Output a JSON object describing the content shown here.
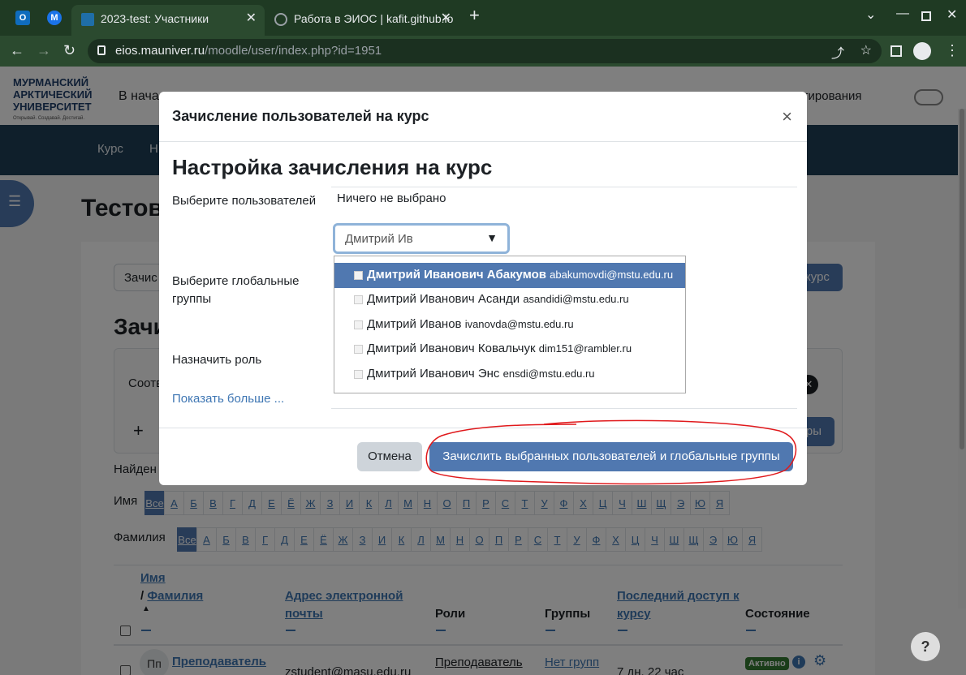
{
  "browser": {
    "tabs": [
      {
        "title": "2023-test: Участники"
      },
      {
        "title": "Работа в ЭИОС | kafit.github.io"
      }
    ],
    "new_tab": "+",
    "url_host": "eios.mauniver.ru",
    "url_path": "/moodle/user/index.php?id=1951"
  },
  "header": {
    "logo_line1": "МУРМАНСКИЙ",
    "logo_line2": "АРКТИЧЕСКИЙ",
    "logo_line3": "УНИВЕРСИТЕТ",
    "logo_tag": "Открывай. Создавай. Достигай.",
    "home_partial": "В начал",
    "edit_mode": "м редактирования"
  },
  "nav": {
    "course": "Курс",
    "second": "Н"
  },
  "background": {
    "page_title_partial": "Тестов",
    "enrol_input_partial": "Зачис",
    "enrol_btn_partial": "курс",
    "section_partial": "Зачи",
    "match_partial": "Соотв",
    "plus": "+",
    "filters_partial": "тры",
    "found_partial": "Найден",
    "name_label": "Имя",
    "surname_label": "Фамилия",
    "all": "Все",
    "letters": [
      "А",
      "Б",
      "В",
      "Г",
      "Д",
      "Е",
      "Ё",
      "Ж",
      "З",
      "И",
      "К",
      "Л",
      "М",
      "Н",
      "О",
      "П",
      "Р",
      "С",
      "Т",
      "У",
      "Ф",
      "Х",
      "Ц",
      "Ч",
      "Ш",
      "Щ",
      "Э",
      "Ю",
      "Я"
    ],
    "table": {
      "col_name_first": "Имя",
      "col_name_sep": "/",
      "col_name_last": "Фамилия",
      "col_email_1": "Адрес электронной",
      "col_email_2": "почты",
      "col_roles": "Роли",
      "col_groups": "Группы",
      "col_access_1": "Последний доступ к",
      "col_access_2": "курсу",
      "col_status": "Состояние",
      "row_initials": "Пп",
      "row_name": "Преподаватель",
      "row_email": "zstudent@masu.edu.ru",
      "row_role": "Преподаватель",
      "row_group": "Нет групп",
      "row_access": "7 дн. 22 час",
      "row_status": "Активно"
    },
    "help": "?"
  },
  "modal": {
    "title": "Зачисление пользователей на курс",
    "close": "×",
    "section_title": "Настройка зачисления на курс",
    "select_users_label": "Выберите пользователей",
    "nothing_selected": "Ничего не выбрано",
    "search_value": "Дмитрий Ив",
    "global_groups_label_1": "Выберите глобальные",
    "global_groups_label_2": "группы",
    "assign_role_label": "Назначить роль",
    "show_more": "Показать больше ...",
    "options": [
      {
        "name": "Дмитрий Иванович Абакумов",
        "email": "abakumovdi@mstu.edu.ru"
      },
      {
        "name": "Дмитрий Иванович Асанди",
        "email": "asandidi@mstu.edu.ru"
      },
      {
        "name": "Дмитрий Иванов",
        "email": "ivanovda@mstu.edu.ru"
      },
      {
        "name": "Дмитрий Иванович Ковальчук",
        "email": "dim151@rambler.ru"
      },
      {
        "name": "Дмитрий Иванович Энс",
        "email": "ensdi@mstu.edu.ru"
      }
    ],
    "cancel": "Отмена",
    "submit": "Зачислить выбранных пользователей и глобальные группы"
  },
  "colors": {
    "primary": "#5078b0",
    "annotation": "#e0191c"
  }
}
